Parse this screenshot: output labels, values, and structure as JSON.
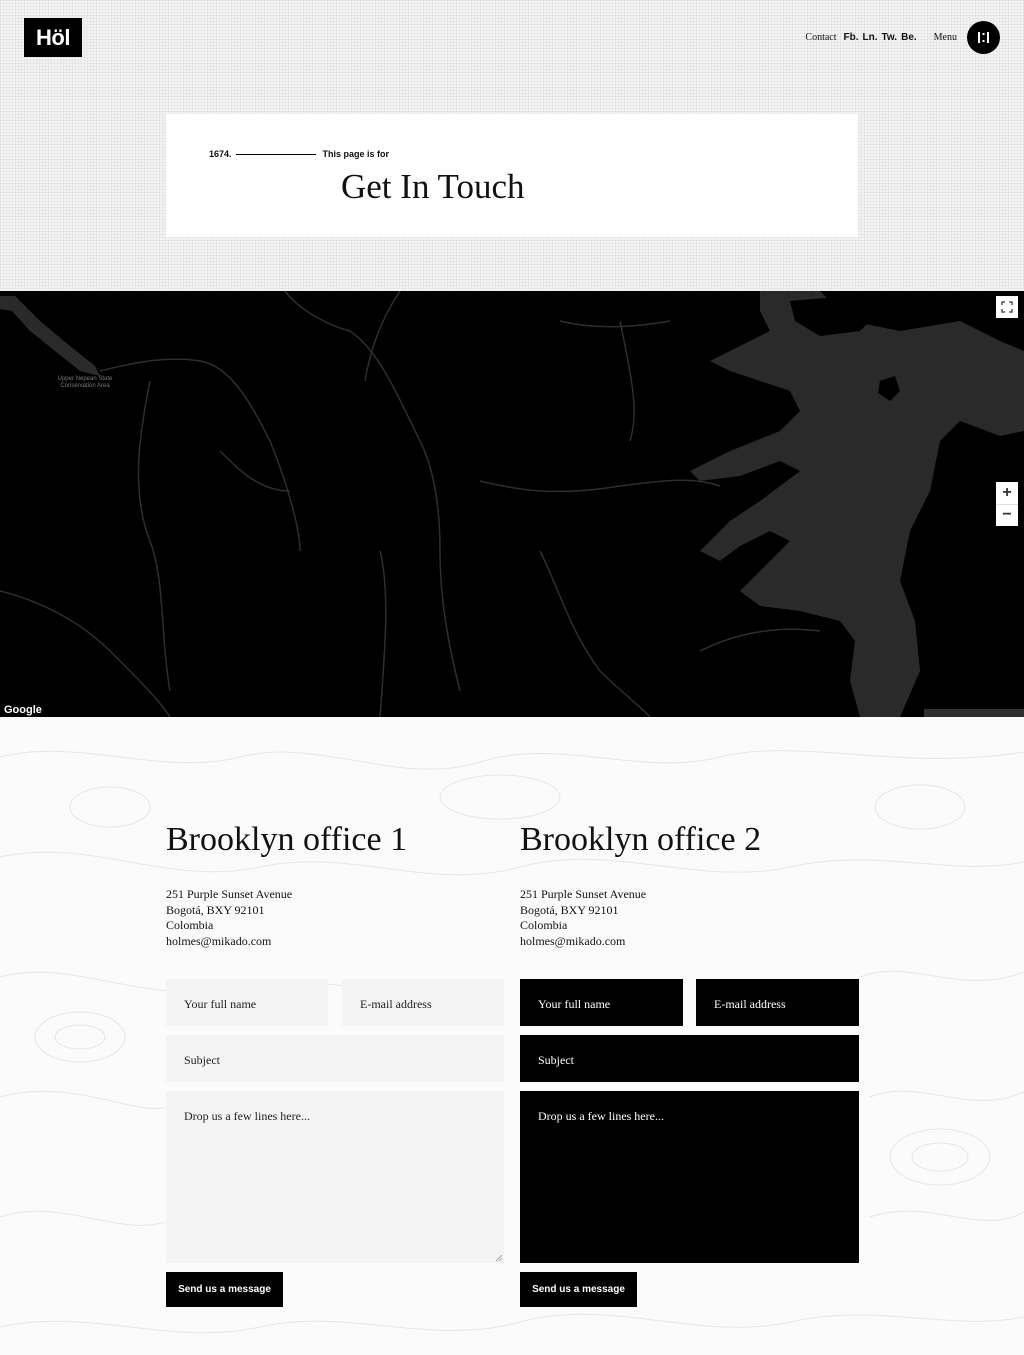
{
  "header": {
    "logo": "Höl",
    "contact": "Contact",
    "social": [
      "Fb.",
      "Ln.",
      "Tw.",
      "Be."
    ],
    "menu_label": "Menu"
  },
  "hero": {
    "number": "1674.",
    "meta_label": "This page is for",
    "title": "Get In Touch"
  },
  "map": {
    "place_label": "Upper Nepean State Conservation Area",
    "zoom_in": "+",
    "zoom_out": "−",
    "attribution": "Google",
    "colors": {
      "land": "#000000",
      "water": "#2a2a2a",
      "roads": "#3a3a3a"
    }
  },
  "offices": [
    {
      "title": "Brooklyn office 1",
      "address": [
        "251 Purple Sunset Avenue",
        "Bogotá, BXY 92101",
        "Colombia",
        "holmes@mikado.com"
      ],
      "form": {
        "name_placeholder": "Your full name",
        "email_placeholder": "E-mail address",
        "subject_placeholder": "Subject",
        "message_placeholder": "Drop us a few lines here...",
        "submit": "Send us a message"
      }
    },
    {
      "title": "Brooklyn office 2",
      "address": [
        "251 Purple Sunset Avenue",
        "Bogotá, BXY 92101",
        "Colombia",
        "holmes@mikado.com"
      ],
      "form": {
        "name_placeholder": "Your full name",
        "email_placeholder": "E-mail address",
        "subject_placeholder": "Subject",
        "message_placeholder": "Drop us a few lines here...",
        "submit": "Send us a message"
      }
    }
  ]
}
